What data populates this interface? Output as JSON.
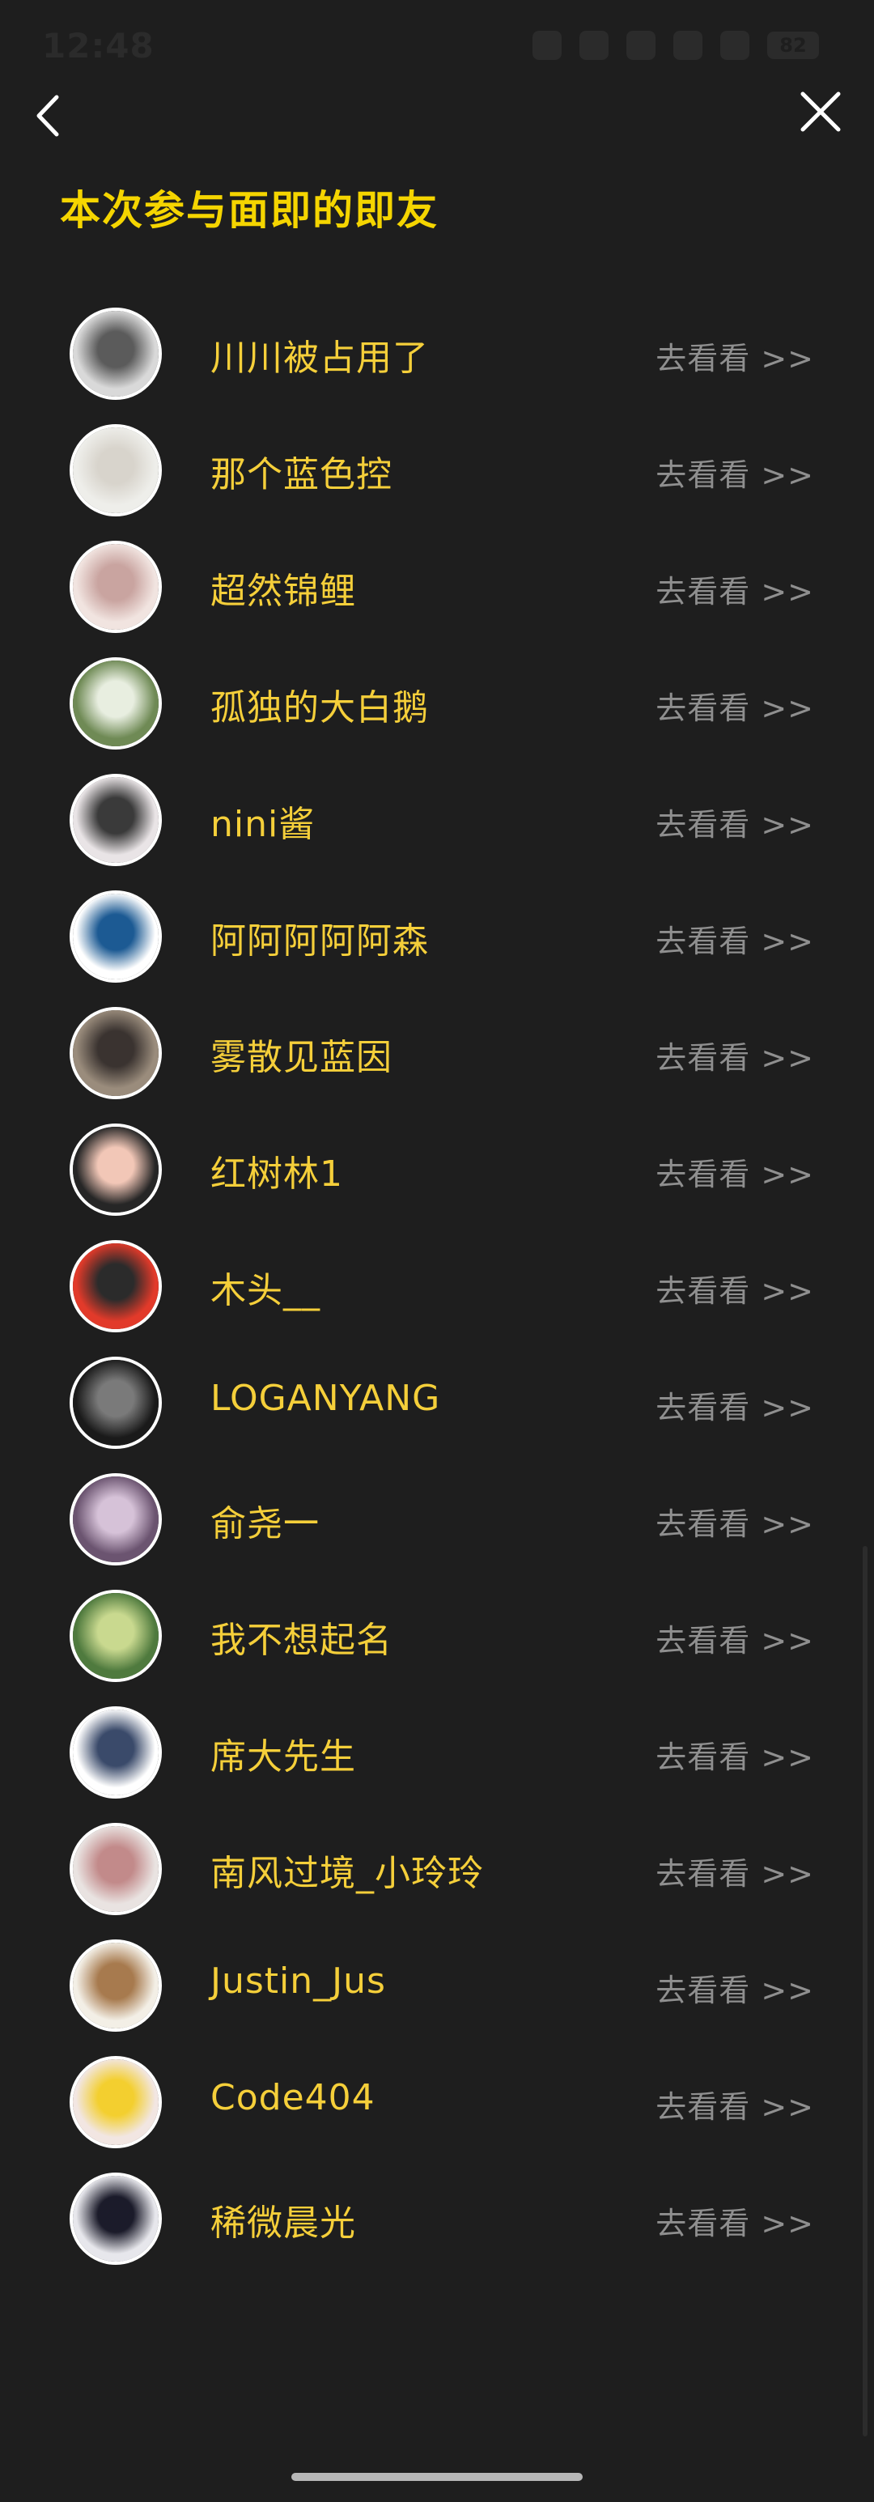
{
  "status_bar": {
    "time": "12:48",
    "battery": "82"
  },
  "header": {
    "title": "本次参与面即的即友"
  },
  "friends": [
    {
      "name": "川川被占用了",
      "action": "去看看 >>",
      "avatar_colors": [
        "#d9d9d9",
        "#5b5b5b"
      ]
    },
    {
      "name": "那个蓝色控",
      "action": "去看看 >>",
      "avatar_colors": [
        "#eeeeea",
        "#d8d4cc"
      ]
    },
    {
      "name": "超然锦鲤",
      "action": "去看看 >>",
      "avatar_colors": [
        "#f1e4e0",
        "#c9a4a0"
      ]
    },
    {
      "name": "孤独的大白鹅",
      "action": "去看看 >>",
      "avatar_colors": [
        "#6f8a55",
        "#e8eee0"
      ]
    },
    {
      "name": "nini酱",
      "action": "去看看 >>",
      "avatar_colors": [
        "#e9e4e6",
        "#3a3a3a"
      ]
    },
    {
      "name": "阿阿阿阿阿森",
      "action": "去看看 >>",
      "avatar_colors": [
        "#ffffff",
        "#1c5a93"
      ]
    },
    {
      "name": "雾散见蓝因",
      "action": "去看看 >>",
      "avatar_colors": [
        "#9a8c7c",
        "#3a3330"
      ]
    },
    {
      "name": "红树林1",
      "action": "去看看 >>",
      "avatar_colors": [
        "#262626",
        "#f2c7b7"
      ]
    },
    {
      "name": "木头__",
      "action": "去看看 >>",
      "avatar_colors": [
        "#e23a2a",
        "#2b2b2b"
      ]
    },
    {
      "name": "LOGANYANG",
      "action": "去看看 >>",
      "avatar_colors": [
        "#1a1a1a",
        "#7a7a7a"
      ]
    },
    {
      "name": "俞尧一",
      "action": "去看看 >>",
      "avatar_colors": [
        "#6b5470",
        "#d6c2d8"
      ]
    },
    {
      "name": "我不想起名",
      "action": "去看看 >>",
      "avatar_colors": [
        "#4f7a3e",
        "#c9d98f"
      ]
    },
    {
      "name": "席大先生",
      "action": "去看看 >>",
      "avatar_colors": [
        "#ffffff",
        "#3a4a6a"
      ]
    },
    {
      "name": "南风过境_小玲玲",
      "action": "去看看 >>",
      "avatar_colors": [
        "#e9e3e1",
        "#c28a8a"
      ]
    },
    {
      "name": "Justin_Jus",
      "action": "去看看 >>",
      "avatar_colors": [
        "#f3efe6",
        "#a77a4e"
      ]
    },
    {
      "name": "Code404",
      "action": "去看看 >>",
      "avatar_colors": [
        "#f2e6e2",
        "#f3cf2f"
      ]
    },
    {
      "name": "稀微晨光",
      "action": "去看看 >>",
      "avatar_colors": [
        "#e7e7ec",
        "#1b1b2a"
      ]
    }
  ],
  "colors": {
    "background": "#1e1e1e",
    "title": "#f5d500",
    "name": "#f5cf3a",
    "action": "#8f8f8f"
  }
}
